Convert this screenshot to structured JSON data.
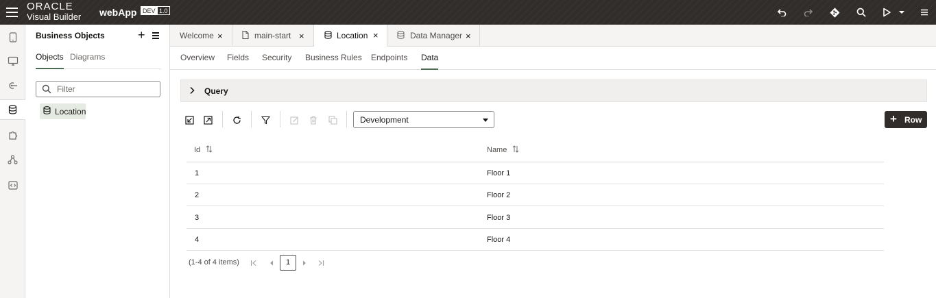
{
  "header": {
    "brand_line1": "ORACLE",
    "brand_line2": "Visual Builder",
    "app_name": "webApp",
    "env_badge": "DEV",
    "version_badge": "1.0",
    "icons": [
      "undo-icon",
      "redo-icon",
      "git-icon",
      "search-icon",
      "run-icon",
      "run-menu-icon",
      "menu-icon"
    ]
  },
  "rail": {
    "items": [
      "mobile-apps-icon",
      "web-apps-icon",
      "services-icon",
      "business-objects-icon",
      "components-icon",
      "processes-icon",
      "source-icon"
    ],
    "active": "business-objects-icon"
  },
  "navigator": {
    "title": "Business Objects",
    "tabs": [
      "Objects",
      "Diagrams"
    ],
    "active_tab": "Objects",
    "filter_placeholder": "Filter",
    "items": [
      "Location"
    ]
  },
  "editor_tabs": [
    {
      "label": "Welcome",
      "icon": "",
      "active": false
    },
    {
      "label": "main-start",
      "icon": "page-icon",
      "active": false
    },
    {
      "label": "Location",
      "icon": "database-icon",
      "active": true
    },
    {
      "label": "Data Manager",
      "icon": "database-icon",
      "active": false
    }
  ],
  "sub_tabs": [
    "Overview",
    "Fields",
    "Security",
    "Business Rules",
    "Endpoints",
    "Data"
  ],
  "active_sub_tab": "Data",
  "query": {
    "label": "Query"
  },
  "toolbar": {
    "buttons": [
      "import-icon",
      "export-icon",
      "refresh-icon",
      "filter-icon",
      "edit-icon",
      "delete-icon",
      "duplicate-icon"
    ],
    "environment": "Development",
    "add_row_label": "Row"
  },
  "table": {
    "columns": [
      "Id",
      "Name"
    ],
    "rows": [
      {
        "id": "1",
        "name": "Floor 1"
      },
      {
        "id": "2",
        "name": "Floor 2"
      },
      {
        "id": "3",
        "name": "Floor 3"
      },
      {
        "id": "4",
        "name": "Floor 4"
      }
    ]
  },
  "pagination": {
    "info": "(1-4 of 4 items)",
    "current_page": "1"
  },
  "colors": {
    "header_bg": "#312d2a",
    "accent": "#4b6b52",
    "selected_item_bg": "#e5ebe2"
  }
}
